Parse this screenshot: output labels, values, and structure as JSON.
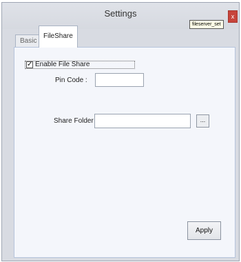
{
  "window": {
    "title": "Settings",
    "close_label": "x",
    "tooltip": "fileserver_set"
  },
  "tabs": [
    {
      "label": "Basic",
      "selected": false
    },
    {
      "label": "FileShare",
      "selected": true
    }
  ],
  "fileshare": {
    "enable_label": "Enable File Share",
    "enable_checked": true,
    "check_glyph": "✓",
    "pin_label": "Pin Code :",
    "pin_value": "",
    "folder_label": "Share Folder",
    "folder_value": "",
    "browse_label": "...",
    "apply_label": "Apply"
  }
}
